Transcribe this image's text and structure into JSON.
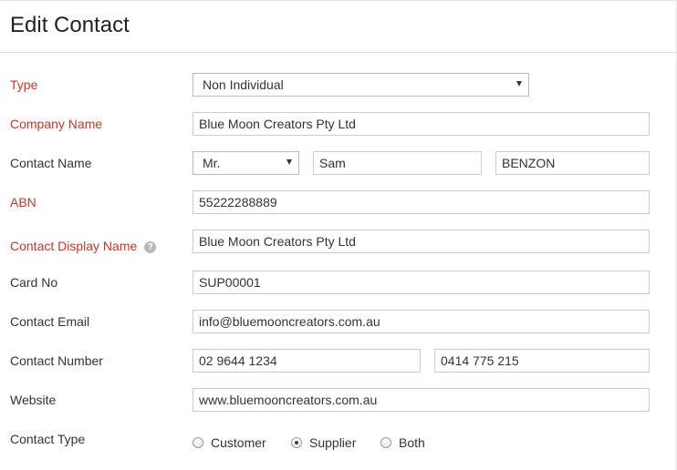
{
  "header": {
    "title": "Edit Contact"
  },
  "form": {
    "type": {
      "label": "Type",
      "value": "Non Individual"
    },
    "company_name": {
      "label": "Company Name",
      "value": "Blue Moon Creators Pty Ltd"
    },
    "contact_name": {
      "label": "Contact Name",
      "salutation": "Mr.",
      "first_name": "Sam",
      "last_name": "BENZON"
    },
    "abn": {
      "label": "ABN",
      "value": "55222288889"
    },
    "display_name": {
      "label": "Contact Display Name",
      "help_icon": "?",
      "value": "Blue Moon Creators Pty Ltd"
    },
    "card_no": {
      "label": "Card No",
      "value": "SUP00001"
    },
    "email": {
      "label": "Contact Email",
      "value": "info@bluemooncreators.com.au"
    },
    "number": {
      "label": "Contact Number",
      "phone": "02 9644 1234",
      "mobile": "0414 775 215"
    },
    "website": {
      "label": "Website",
      "value": "www.bluemooncreators.com.au"
    },
    "contact_type": {
      "label": "Contact Type",
      "options": [
        "Customer",
        "Supplier",
        "Both"
      ],
      "selected": "Supplier"
    }
  },
  "colors": {
    "required_label": "#c0392b",
    "border": "#cccccc"
  }
}
